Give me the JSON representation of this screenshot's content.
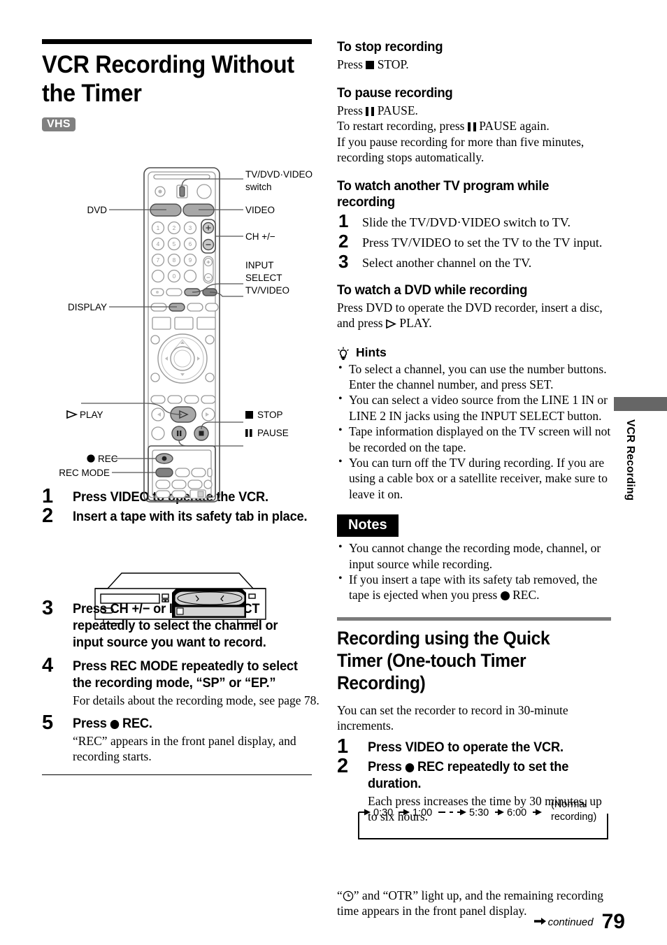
{
  "page": {
    "number": "79",
    "continued_label": "continued",
    "side_tab": "VCR Recording"
  },
  "main": {
    "title": "VCR Recording Without the Timer",
    "media_badge": "VHS"
  },
  "remote_labels": {
    "tv_dvd_video_switch": "TV/DVD·VIDEO",
    "tv_dvd_video_switch_2": "switch",
    "dvd": "DVD",
    "video": "VIDEO",
    "ch": "CH +/−",
    "input_select_1": "INPUT",
    "input_select_2": "SELECT",
    "tv_video": "TV/VIDEO",
    "display": "DISPLAY",
    "play": "PLAY",
    "stop": "STOP",
    "pause": "PAUSE",
    "rec": "REC",
    "rec_mode": "REC MODE"
  },
  "remote_keypad": {
    "numbers": [
      "1",
      "2",
      "3",
      "4",
      "5",
      "6",
      "7",
      "8",
      "9",
      "0"
    ]
  },
  "steps_main": [
    {
      "num": "1",
      "text": "Press VIDEO to operate the VCR."
    },
    {
      "num": "2",
      "text": "Insert a tape with its safety tab in place."
    },
    {
      "num": "3",
      "text": "Press CH +/− or INPUT SELECT repeatedly to select the channel or input source you want to record."
    },
    {
      "num": "4",
      "text": "Press REC MODE repeatedly to select the recording mode, “SP” or “EP.”",
      "sub": "For details about the recording mode, see page 78."
    },
    {
      "num": "5",
      "text_pre": "Press ",
      "text_post": " REC.",
      "sub": "“REC” appears in the front panel display, and recording starts."
    }
  ],
  "stop_section": {
    "heading": "To stop recording",
    "line_pre": "Press ",
    "line_post": " STOP."
  },
  "pause_section": {
    "heading": "To pause recording",
    "l1_pre": "Press ",
    "l1_post": " PAUSE.",
    "l2_pre": "To restart recording, press ",
    "l2_post": " PAUSE again.",
    "l3": "If you pause recording for more than five minutes, recording stops automatically."
  },
  "watch_tv_section": {
    "heading": "To watch another TV program while recording",
    "steps": [
      {
        "num": "1",
        "text": "Slide the TV/DVD·VIDEO switch to TV."
      },
      {
        "num": "2",
        "text": "Press TV/VIDEO to set the TV to the TV input."
      },
      {
        "num": "3",
        "text": "Select another channel on the TV."
      }
    ]
  },
  "watch_dvd_section": {
    "heading": "To watch a DVD while recording",
    "text_pre": "Press DVD to operate the DVD recorder, insert a disc, and press ",
    "text_post": " PLAY."
  },
  "hints": {
    "heading": "Hints",
    "items": [
      "To select a channel, you can use the number buttons. Enter the channel number, and press SET.",
      "You can select a video source from the LINE 1 IN or LINE 2 IN jacks using the INPUT SELECT button.",
      "Tape information displayed on the TV screen will not be recorded on the tape.",
      "You can turn off the TV during recording. If you are using a cable box or a satellite receiver, make sure to leave it on."
    ]
  },
  "notes": {
    "heading": "Notes",
    "item1": "You cannot change the recording mode, channel, or input source while recording.",
    "item2_pre": "If you insert a tape with its safety tab removed, the tape is ejected when you press ",
    "item2_post": " REC."
  },
  "quick_timer": {
    "heading": "Recording using the Quick Timer (One-touch Timer Recording)",
    "intro": "You can set the recorder to record in 30-minute increments.",
    "steps": [
      {
        "num": "1",
        "text": "Press VIDEO to operate the VCR."
      },
      {
        "num": "2",
        "text_pre": "Press ",
        "text_post": " REC repeatedly to set the duration.",
        "sub": "Each press increases the time by 30 minutes, up to six hours."
      }
    ],
    "closing_pre": "“",
    "closing_post": "” and “OTR” light up, and the remaining recording time appears in the front panel display."
  },
  "timer_diagram": {
    "values": [
      "0:30",
      "1:00",
      "5:30",
      "6:00"
    ],
    "dashes": "— - -",
    "end_label_1": "(Normal",
    "end_label_2": "recording)"
  },
  "colors": {
    "accent_gray": "#808080",
    "tab_gray": "#666666",
    "rule_gray": "#7a7a7a",
    "black": "#000000"
  }
}
